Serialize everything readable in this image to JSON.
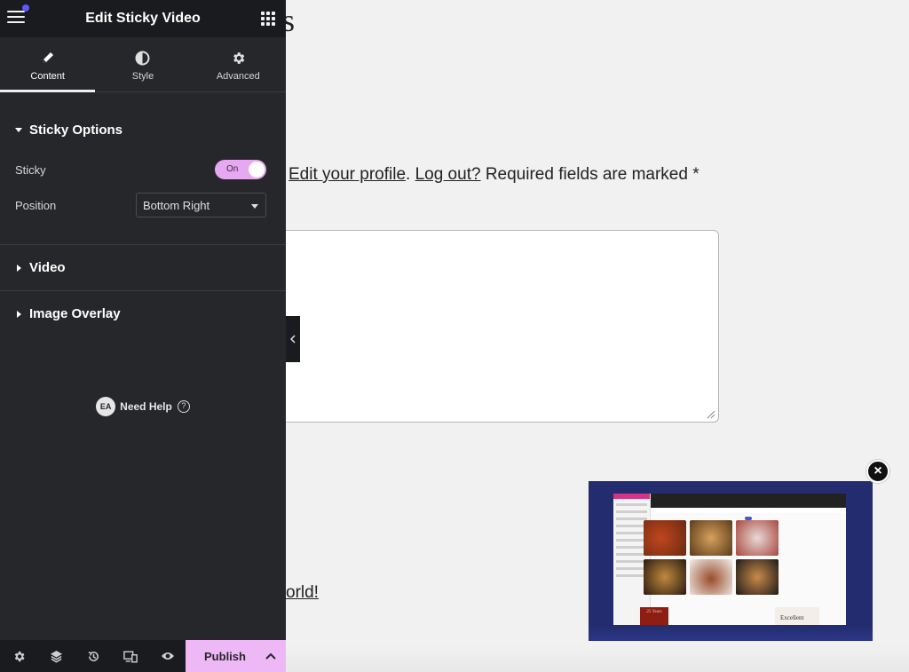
{
  "panel": {
    "title": "Edit Sticky Video",
    "tabs": [
      {
        "label": "Content",
        "icon": "pencil-icon",
        "active": true
      },
      {
        "label": "Style",
        "icon": "half-circle-icon",
        "active": false
      },
      {
        "label": "Advanced",
        "icon": "gear-icon",
        "active": false
      }
    ],
    "sticky_options": {
      "title": "Sticky Options",
      "sticky_label": "Sticky",
      "sticky_toggle": "On",
      "position_label": "Position",
      "position_value": "Bottom Right"
    },
    "video_section": "Video",
    "image_overlay_section": "Image Overlay",
    "help": {
      "badge": "EA",
      "text": "Need Help",
      "icon": "?"
    },
    "footer": {
      "icons": [
        "settings-icon",
        "layers-icon",
        "history-icon",
        "responsive-icon",
        "preview-eye-icon"
      ],
      "publish": "Publish"
    },
    "accent_color": "#eeb7f5"
  },
  "canvas": {
    "heading_fragment": "s",
    "logged_in": {
      "edit_profile": "Edit your profile",
      "sep": ".",
      "log_out": "Log out?",
      "required": "Required fields are marked",
      "asterisk": "*"
    },
    "link_fragment": "orld!",
    "sticky_video": {
      "close": "×",
      "red_box_text": "25 Years",
      "card_text": "Excellent"
    }
  }
}
